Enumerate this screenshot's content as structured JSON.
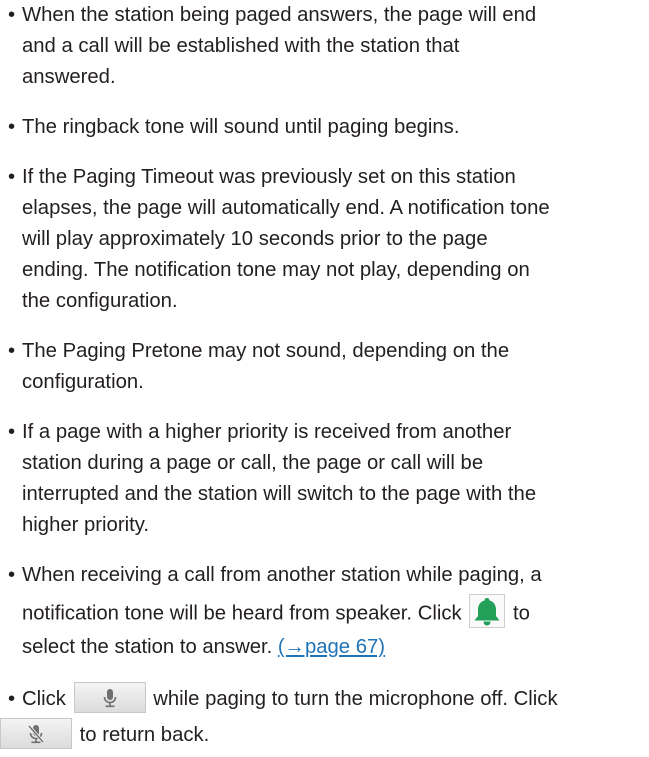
{
  "bullets": [
    {
      "lines": [
        "When the station being paged answers, the page will end",
        "and a call will be established with the station that",
        "answered."
      ]
    },
    {
      "lines": [
        "The ringback tone will sound until paging begins."
      ]
    },
    {
      "lines": [
        "If the Paging Timeout was previously set on this station",
        "elapses, the page will automatically end. A notification tone",
        "will play approximately 10 seconds prior to the page",
        "ending. The notification tone may not play, depending on",
        "the configuration."
      ]
    },
    {
      "lines": [
        "The Paging Pretone may not sound, depending on the",
        "configuration."
      ]
    },
    {
      "lines": [
        "If a page with a higher priority is received from another",
        "station during a page or call, the page or call will be",
        "interrupted and the station will switch to the page with the",
        "higher priority."
      ]
    },
    {
      "line1": "When receiving a call from another station while paging, a",
      "line2_before": "notification tone will be heard from speaker. Click",
      "line2_after": "to",
      "line3_before": "select the station to answer.",
      "link_text": "(→page 67)"
    },
    {
      "click_label": "Click",
      "line1_after": "while paging to turn the microphone off. Click",
      "line2_after": "to return back."
    }
  ],
  "bullet_char": "•",
  "colors": {
    "text": "#231f20",
    "link": "#1f73b7",
    "bell": "#22a05a"
  },
  "icons": {
    "bell": "bell-icon",
    "mic_on": "microphone-icon",
    "mic_off": "microphone-off-icon"
  }
}
